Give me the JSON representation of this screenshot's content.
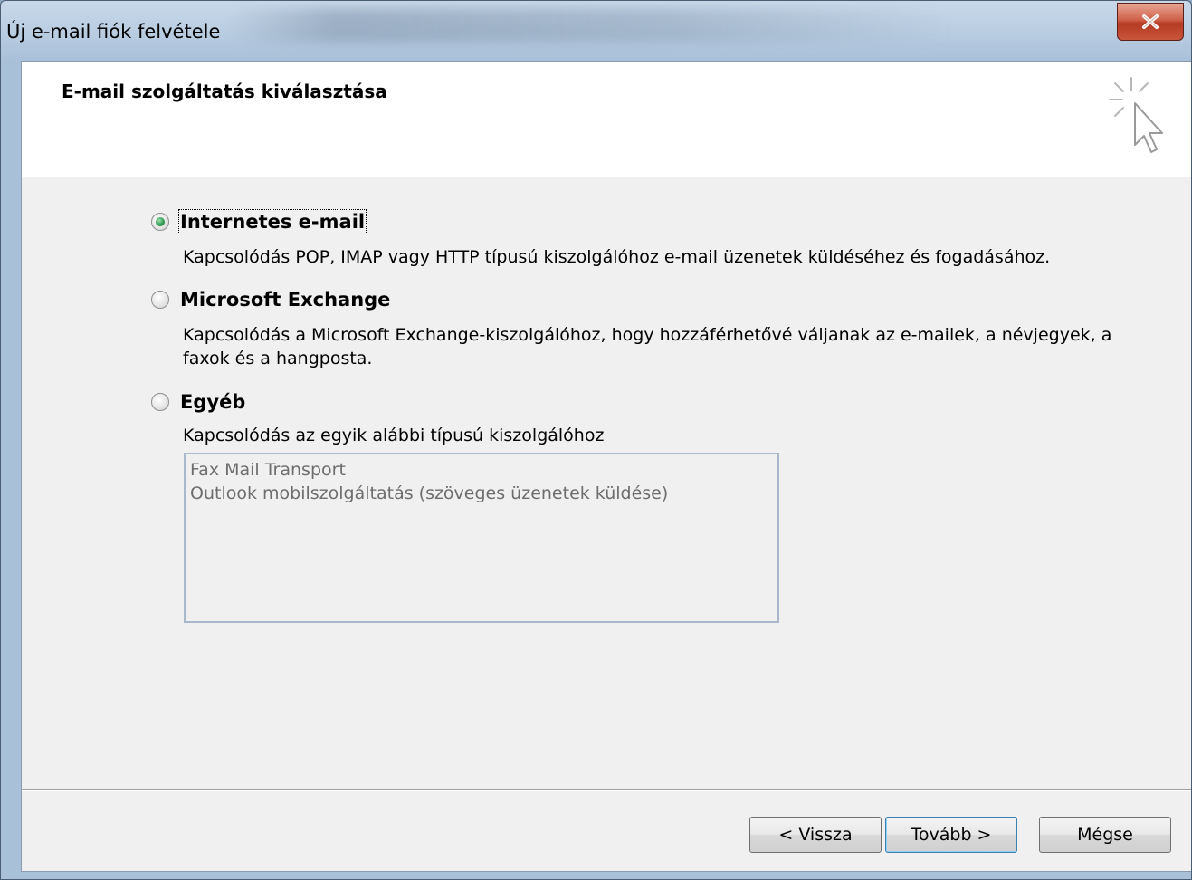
{
  "window": {
    "title": "Új e-mail fiók felvétele"
  },
  "header": {
    "title": "E-mail szolgáltatás kiválasztása"
  },
  "options": [
    {
      "label": "Internetes e-mail",
      "checked": true,
      "description": "Kapcsolódás POP, IMAP vagy HTTP típusú kiszolgálóhoz e-mail üzenetek küldéséhez és fogadásához."
    },
    {
      "label": "Microsoft Exchange",
      "checked": false,
      "description_line1": "Kapcsolódás a Microsoft Exchange-kiszolgálóhoz, hogy hozzáférhetővé váljanak az e-mailek, a névjegyek, a",
      "description_line2": "faxok és a hangposta."
    },
    {
      "label": "Egyéb",
      "checked": false,
      "description": "Kapcsolódás az egyik alábbi típusú kiszolgálóhoz"
    }
  ],
  "other_servers": [
    "Fax Mail Transport",
    "Outlook mobilszolgáltatás (szöveges üzenetek küldése)"
  ],
  "buttons": {
    "back": "< Vissza",
    "next": "Tovább >",
    "cancel": "Mégse"
  },
  "icons": {
    "close": "close-icon",
    "wizard": "wizard-cursor-icon"
  },
  "colors": {
    "radio_checked": "#2e9a4e",
    "close_button": "#c9563c",
    "default_button_border": "#3c7fb1"
  }
}
